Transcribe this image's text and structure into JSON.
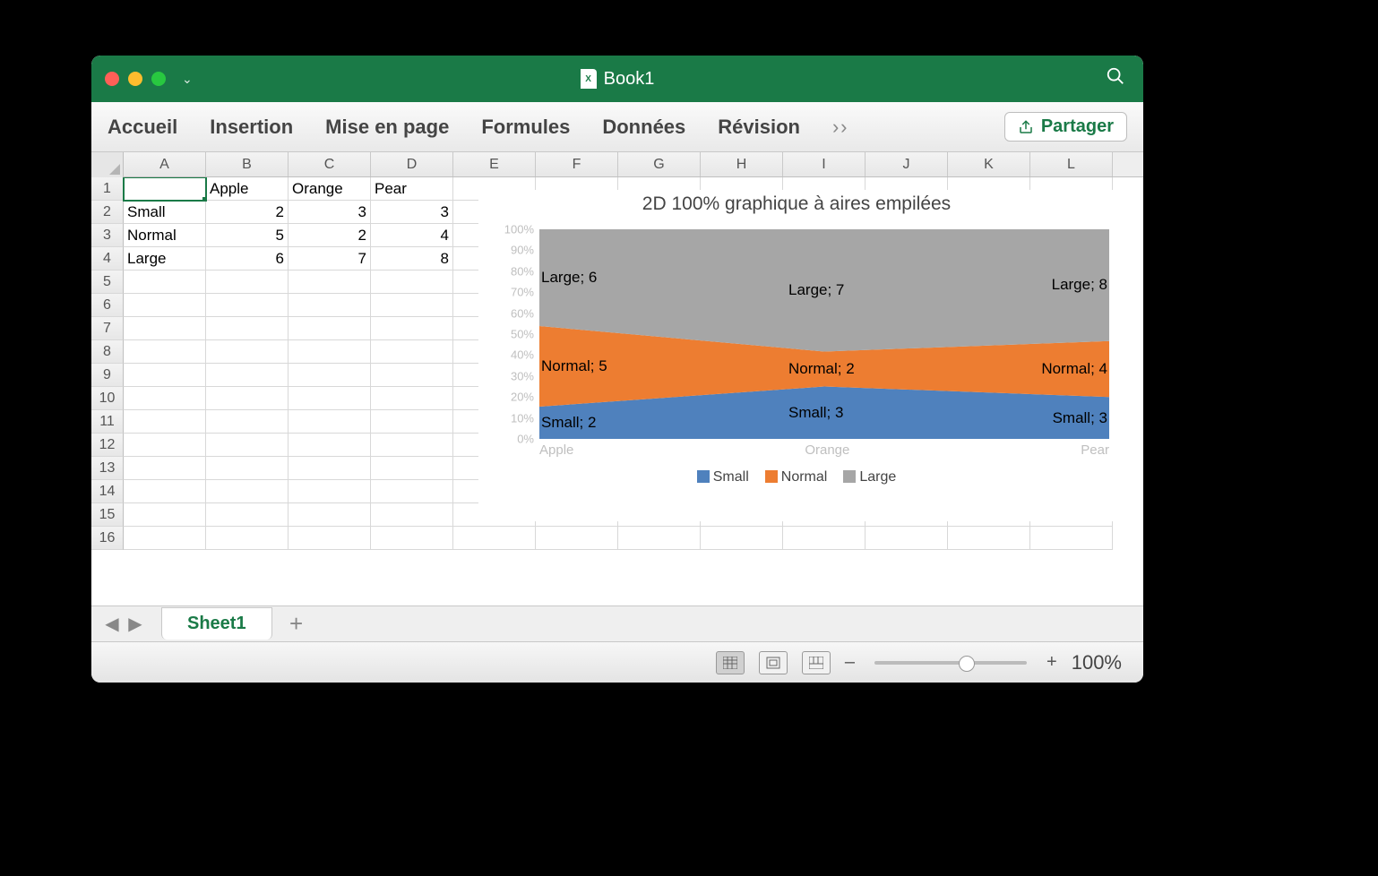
{
  "window": {
    "title": "Book1"
  },
  "ribbon": {
    "tabs": [
      "Accueil",
      "Insertion",
      "Mise en page",
      "Formules",
      "Données",
      "Révision"
    ],
    "share_label": "Partager"
  },
  "columns": [
    "A",
    "B",
    "C",
    "D",
    "E",
    "F",
    "G",
    "H",
    "I",
    "J",
    "K",
    "L"
  ],
  "rows_visible": 16,
  "table": {
    "headers": [
      "",
      "Apple",
      "Orange",
      "Pear"
    ],
    "rows": [
      {
        "label": "Small",
        "values": [
          2,
          3,
          3
        ]
      },
      {
        "label": "Normal",
        "values": [
          5,
          2,
          4
        ]
      },
      {
        "label": "Large",
        "values": [
          6,
          7,
          8
        ]
      }
    ],
    "selected_cell": "A1"
  },
  "sheet_tabs": {
    "active": "Sheet1"
  },
  "statusbar": {
    "zoom": "100%"
  },
  "chart_data": {
    "type": "area",
    "stacked": "100%",
    "title": "2D 100% graphique à aires empilées",
    "categories": [
      "Apple",
      "Orange",
      "Pear"
    ],
    "series": [
      {
        "name": "Small",
        "values": [
          2,
          3,
          3
        ],
        "color": "#4f81bd"
      },
      {
        "name": "Normal",
        "values": [
          5,
          2,
          4
        ],
        "color": "#ed7d31"
      },
      {
        "name": "Large",
        "values": [
          6,
          7,
          8
        ],
        "color": "#a6a6a6"
      }
    ],
    "ylabel": "",
    "xlabel": "",
    "ylim": [
      0,
      100
    ],
    "yticks": [
      "0%",
      "10%",
      "20%",
      "30%",
      "40%",
      "50%",
      "60%",
      "70%",
      "80%",
      "90%",
      "100%"
    ],
    "data_labels": [
      {
        "series": "Small",
        "cat": "Apple",
        "text": "Small; 2"
      },
      {
        "series": "Small",
        "cat": "Orange",
        "text": "Small; 3"
      },
      {
        "series": "Small",
        "cat": "Pear",
        "text": "Small; 3"
      },
      {
        "series": "Normal",
        "cat": "Apple",
        "text": "Normal; 5"
      },
      {
        "series": "Normal",
        "cat": "Orange",
        "text": "Normal; 2"
      },
      {
        "series": "Normal",
        "cat": "Pear",
        "text": "Normal; 4"
      },
      {
        "series": "Large",
        "cat": "Apple",
        "text": "Large; 6"
      },
      {
        "series": "Large",
        "cat": "Orange",
        "text": "Large; 7"
      },
      {
        "series": "Large",
        "cat": "Pear",
        "text": "Large; 8"
      }
    ]
  }
}
